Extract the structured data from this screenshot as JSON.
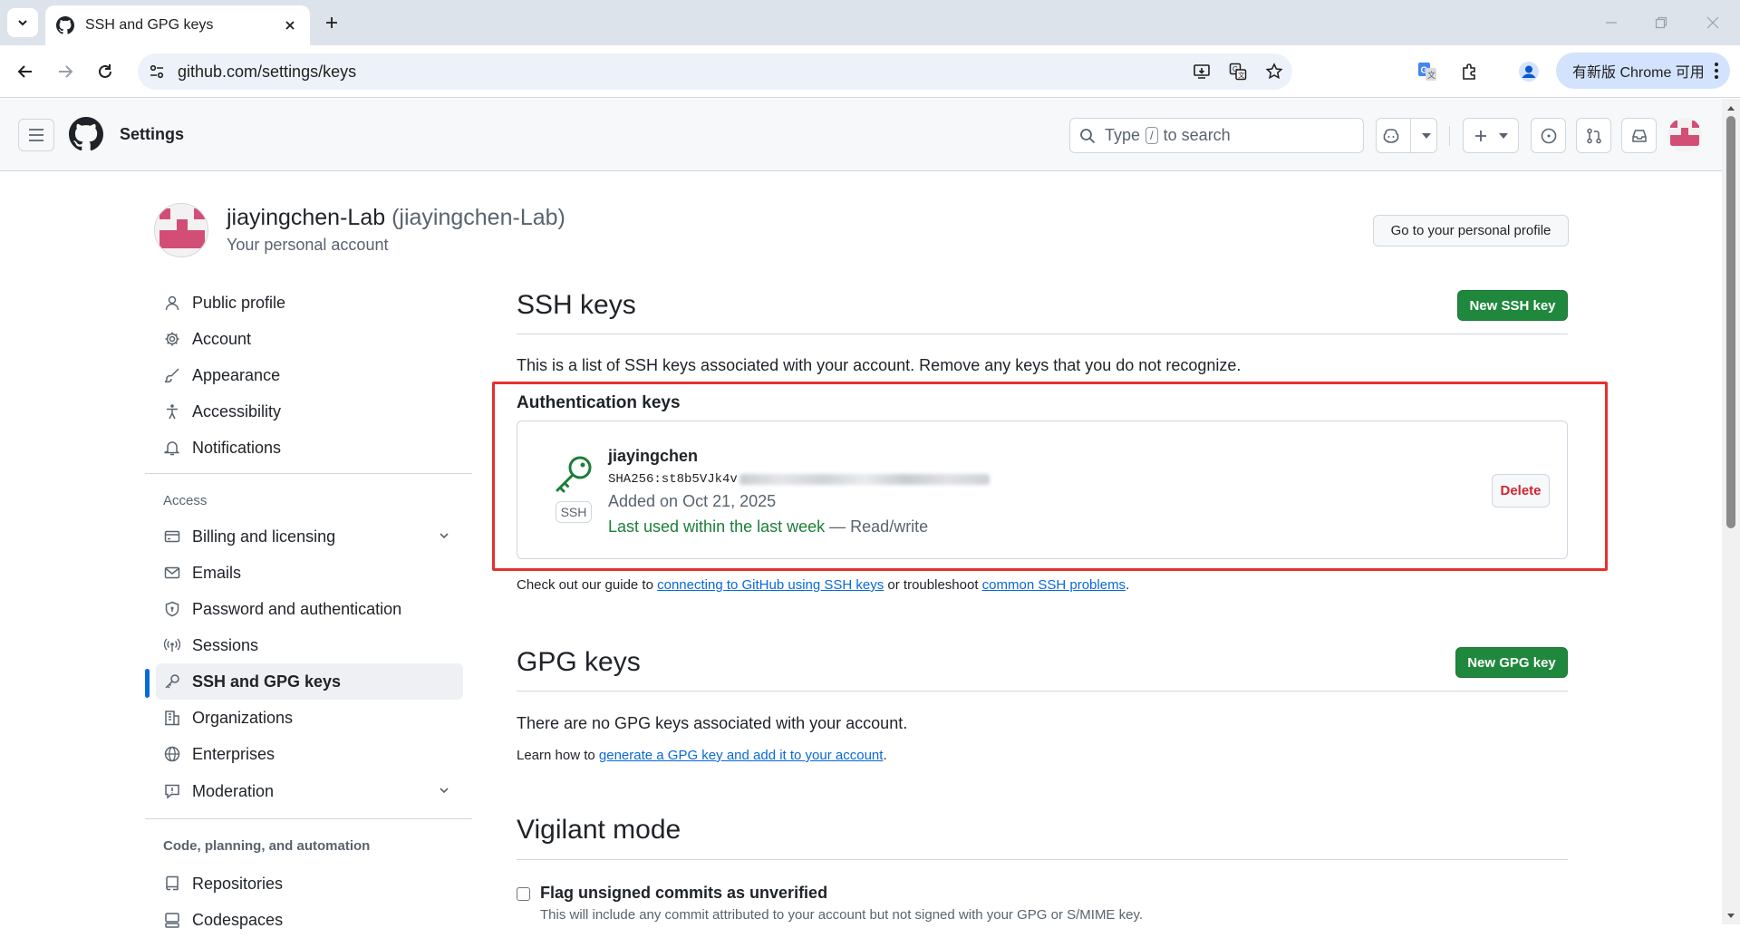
{
  "browser": {
    "tab_title": "SSH and GPG keys",
    "url": "github.com/settings/keys",
    "update_label": "有新版 Chrome 可用"
  },
  "header": {
    "context": "Settings",
    "search_prefix": "Type",
    "search_key": "/",
    "search_suffix": "to search"
  },
  "profile": {
    "name": "jiayingchen-Lab",
    "login": "(jiayingchen-Lab)",
    "subtitle": "Your personal account",
    "goto_button": "Go to your personal profile"
  },
  "sidebar": {
    "items": [
      {
        "label": "Public profile",
        "icon": "person-icon"
      },
      {
        "label": "Account",
        "icon": "gear-icon"
      },
      {
        "label": "Appearance",
        "icon": "paintbrush-icon"
      },
      {
        "label": "Accessibility",
        "icon": "accessibility-icon"
      },
      {
        "label": "Notifications",
        "icon": "bell-icon"
      }
    ],
    "access_heading": "Access",
    "access_items": [
      {
        "label": "Billing and licensing",
        "icon": "credit-card-icon"
      },
      {
        "label": "Emails",
        "icon": "mail-icon"
      },
      {
        "label": "Password and authentication",
        "icon": "shield-lock-icon"
      },
      {
        "label": "Sessions",
        "icon": "broadcast-icon"
      },
      {
        "label": "SSH and GPG keys",
        "icon": "key-icon"
      },
      {
        "label": "Organizations",
        "icon": "organization-icon"
      },
      {
        "label": "Enterprises",
        "icon": "globe-icon"
      },
      {
        "label": "Moderation",
        "icon": "report-icon"
      }
    ],
    "code_heading": "Code, planning, and automation",
    "code_items": [
      {
        "label": "Repositories",
        "icon": "repo-icon"
      },
      {
        "label": "Codespaces",
        "icon": "codespaces-icon"
      }
    ]
  },
  "ssh": {
    "title": "SSH keys",
    "new_button": "New SSH key",
    "description": "This is a list of SSH keys associated with your account. Remove any keys that you do not recognize.",
    "auth_title": "Authentication keys",
    "key": {
      "badge": "SSH",
      "name": "jiayingchen",
      "fingerprint_visible": "SHA256:st8b5VJk4v",
      "added": "Added on Oct 21, 2025",
      "last_used": "Last used within the last week",
      "access": "— Read/write",
      "delete_button": "Delete"
    },
    "guide_prefix": "Check out our guide to",
    "guide_link1": "connecting to GitHub using SSH keys",
    "guide_mid": "or troubleshoot",
    "guide_link2": "common SSH problems",
    "guide_end": "."
  },
  "gpg": {
    "title": "GPG keys",
    "new_button": "New GPG key",
    "empty": "There are no GPG keys associated with your account.",
    "learn_prefix": "Learn how to",
    "learn_link": "generate a GPG key and add it to your account",
    "learn_end": "."
  },
  "vigilant": {
    "title": "Vigilant mode",
    "checkbox_label": "Flag unsigned commits as unverified",
    "checked": false,
    "note": "This will include any commit attributed to your account but not signed with your GPG or S/MIME key."
  },
  "colors": {
    "accent": "#0969da",
    "primary_button": "#1f883d",
    "danger": "#d1242f",
    "highlight_box": "#e5302e"
  }
}
